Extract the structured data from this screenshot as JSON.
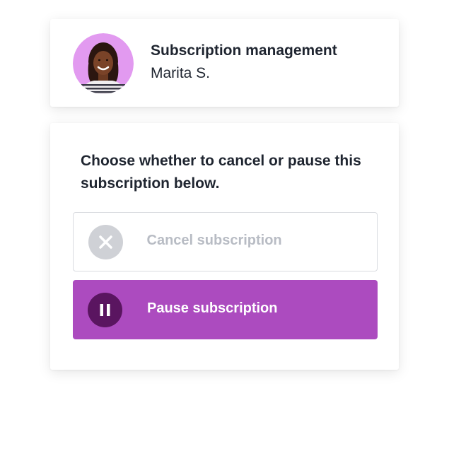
{
  "header": {
    "title": "Subscription management",
    "name": "Marita S.",
    "avatar_icon": "user-avatar-photo"
  },
  "main": {
    "prompt": "Choose whether to cancel or pause this subscription below.",
    "options": [
      {
        "label": "Cancel subscription",
        "icon": "close-x-icon"
      },
      {
        "label": "Pause subscription",
        "icon": "pause-icon"
      }
    ]
  },
  "colors": {
    "accent": "#ac4bbf",
    "accent_dark": "#5a1560",
    "avatar_bg": "#e29af0",
    "muted": "#cfd1d6"
  }
}
